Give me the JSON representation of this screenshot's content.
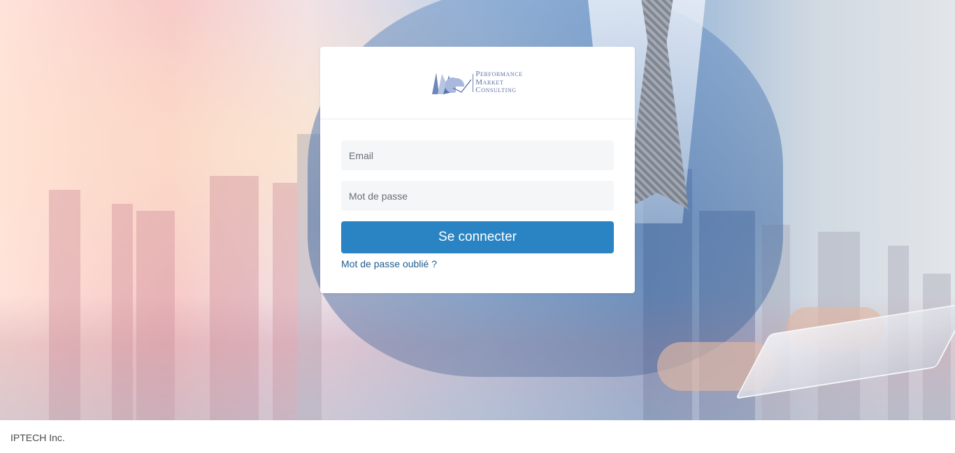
{
  "logo": {
    "line1": "Performance",
    "line2": "Market",
    "line3": "Consulting"
  },
  "login": {
    "email_placeholder": "Email",
    "password_placeholder": "Mot de passe",
    "submit_label": "Se connecter",
    "forgot_link": "Mot de passe oublié ?"
  },
  "footer": {
    "text": "IPTECH Inc."
  },
  "colors": {
    "primary_button": "#2a84c3",
    "link": "#1f5d8f",
    "input_background": "#f5f6f8"
  }
}
